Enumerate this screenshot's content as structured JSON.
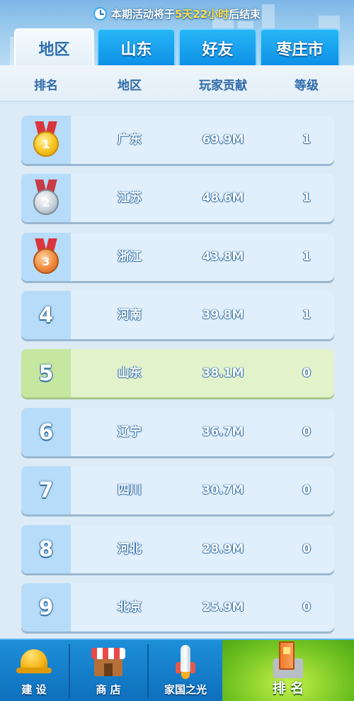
{
  "countdown": {
    "prefix": "本期活动将于",
    "days": "5天",
    "hours": "22小时",
    "suffix": "后结束"
  },
  "tabs": [
    {
      "label": "地区",
      "active": true
    },
    {
      "label": "山东",
      "active": false
    },
    {
      "label": "好友",
      "active": false
    },
    {
      "label": "枣庄市",
      "active": false
    }
  ],
  "columns": {
    "rank": "排名",
    "region": "地区",
    "contribution": "玩家贡献",
    "level": "等级"
  },
  "rows": [
    {
      "rank": "1",
      "medal": "gold-medal-icon",
      "region": "广东",
      "contribution": "69.9M",
      "level": "1"
    },
    {
      "rank": "2",
      "medal": "silver-medal-icon",
      "region": "江苏",
      "contribution": "48.6M",
      "level": "1"
    },
    {
      "rank": "3",
      "medal": "bronze-medal-icon",
      "region": "浙江",
      "contribution": "43.8M",
      "level": "1"
    },
    {
      "rank": "4",
      "region": "河南",
      "contribution": "39.8M",
      "level": "1"
    },
    {
      "rank": "5",
      "region": "山东",
      "contribution": "38.1M",
      "level": "0",
      "highlighted": true
    },
    {
      "rank": "6",
      "region": "辽宁",
      "contribution": "36.7M",
      "level": "0"
    },
    {
      "rank": "7",
      "region": "四川",
      "contribution": "30.7M",
      "level": "0"
    },
    {
      "rank": "8",
      "region": "河北",
      "contribution": "28.9M",
      "level": "0"
    },
    {
      "rank": "9",
      "region": "北京",
      "contribution": "25.9M",
      "level": "0"
    }
  ],
  "bottom_nav": [
    {
      "label": "建 设",
      "icon": "helmet-icon"
    },
    {
      "label": "商 店",
      "icon": "shop-icon"
    },
    {
      "label": "家国之光",
      "icon": "rocket-icon"
    },
    {
      "label": "排 名",
      "icon": "ranking-tower-icon",
      "active": true
    }
  ],
  "colors": {
    "active_tab_text": "#2b6fb0",
    "inactive_tab_bg": "#12a0ee",
    "highlight_row_bg": "#e2f3cc",
    "row_bg": "#e1effc",
    "countdown_highlight": "#ffe34d",
    "active_nav_bg": "#76c623"
  }
}
